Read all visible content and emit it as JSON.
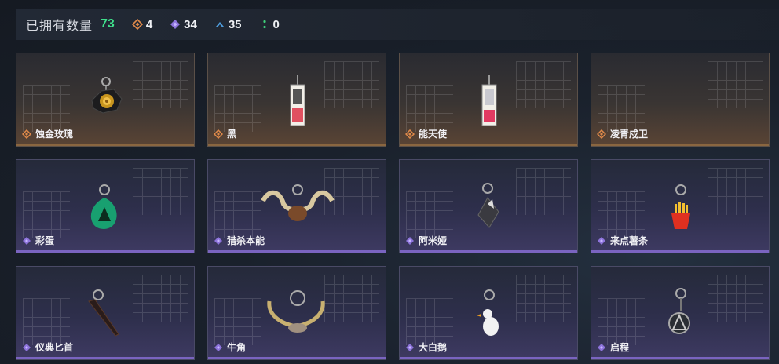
{
  "header": {
    "owned_label": "已拥有数量",
    "owned_count": "73",
    "stats": [
      {
        "icon": "orange-diamond-icon",
        "value": "4",
        "color": "#e08a4a"
      },
      {
        "icon": "purple-diamond-icon",
        "value": "34",
        "color": "#9b7ee6"
      },
      {
        "icon": "blue-chevron-icon",
        "value": "35",
        "color": "#4f9fe0"
      },
      {
        "icon": "green-dots-icon",
        "value": "0",
        "color": "#3fd07a"
      }
    ]
  },
  "items": [
    {
      "name": "蚀金玫瑰",
      "rarity": "orange",
      "icon": "golden-rose-charm-icon"
    },
    {
      "name": "黑",
      "rarity": "orange",
      "icon": "tag-charm-icon"
    },
    {
      "name": "能天使",
      "rarity": "orange",
      "icon": "tag-charm-icon"
    },
    {
      "name": "凌青戍卫",
      "rarity": "orange",
      "icon": "empty-icon"
    },
    {
      "name": "彩蛋",
      "rarity": "purple",
      "icon": "green-egg-charm-icon"
    },
    {
      "name": "猎杀本能",
      "rarity": "purple",
      "icon": "antler-charm-icon"
    },
    {
      "name": "阿米娅",
      "rarity": "purple",
      "icon": "bunny-charm-icon"
    },
    {
      "name": "来点薯条",
      "rarity": "purple",
      "icon": "fries-charm-icon"
    },
    {
      "name": "仪典匕首",
      "rarity": "purple",
      "icon": "dagger-charm-icon"
    },
    {
      "name": "牛角",
      "rarity": "purple",
      "icon": "horn-charm-icon"
    },
    {
      "name": "大白鹅",
      "rarity": "purple",
      "icon": "goose-charm-icon"
    },
    {
      "name": "启程",
      "rarity": "purple",
      "icon": "emblem-charm-icon"
    }
  ]
}
